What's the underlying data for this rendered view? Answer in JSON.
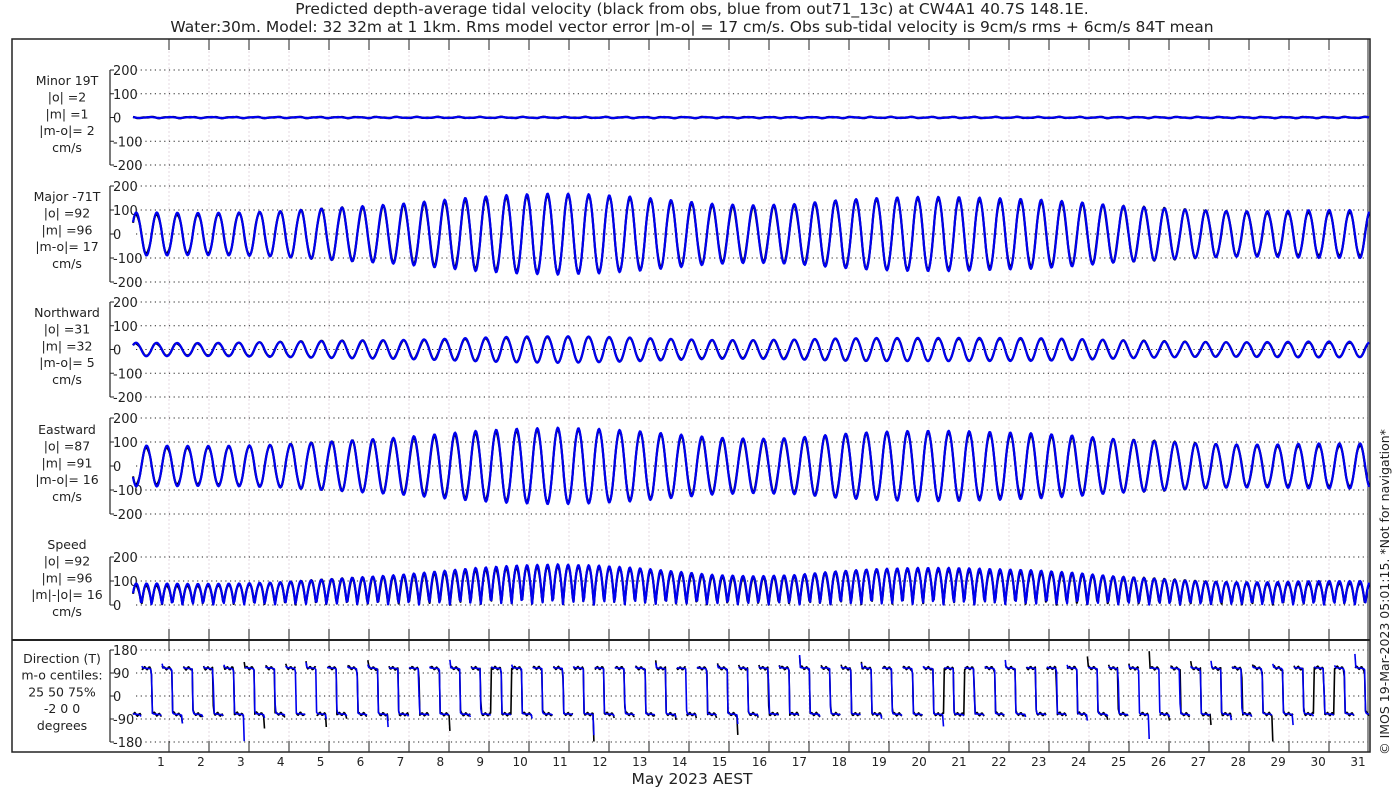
{
  "chart_data": {
    "type": "line",
    "title": "Predicted depth-average tidal velocity (black from obs, blue from out71_13c) at CW4A1 40.7S 148.1E.",
    "subtitle": "Water:30m. Model: 32 32m at 1 1km. Rms model vector error |m-o| = 17 cm/s. Obs sub-tidal velocity is 9cm/s rms + 6cm/s 84T mean",
    "xlabel": "May 2023 AEST",
    "x_tick_labels": [
      "1",
      "2",
      "3",
      "4",
      "5",
      "6",
      "7",
      "8",
      "9",
      "10",
      "11",
      "12",
      "13",
      "14",
      "15",
      "16",
      "17",
      "18",
      "19",
      "20",
      "21",
      "22",
      "23",
      "24",
      "25",
      "26",
      "27",
      "28",
      "29",
      "30",
      "31"
    ],
    "xlim_days": [
      0.35,
      31.45
    ],
    "grid": true,
    "series_colors": {
      "obs": "#000000",
      "model": "#0000ee"
    },
    "tidal_period_days": 0.5175,
    "major_axis_deg": -71,
    "major_envelope_cm_s_by_day": [
      90,
      90,
      88,
      90,
      95,
      105,
      115,
      125,
      140,
      155,
      165,
      170,
      165,
      155,
      140,
      125,
      120,
      125,
      140,
      150,
      155,
      155,
      150,
      145,
      135,
      120,
      110,
      100,
      95,
      95,
      100,
      100
    ],
    "minor_amplitude_cm_s": 2,
    "panels": [
      {
        "id": "minor",
        "labels": [
          "Minor 19T",
          "|o| =2",
          "|m| =1",
          "|m-o|= 2",
          "cm/s"
        ],
        "yticks": [
          200,
          100,
          0,
          -100,
          -200
        ],
        "ylim": [
          -200,
          200
        ]
      },
      {
        "id": "major",
        "labels": [
          "Major -71T",
          "|o| =92",
          "|m| =96",
          "|m-o|= 17",
          "cm/s"
        ],
        "yticks": [
          200,
          100,
          0,
          -100,
          -200
        ],
        "ylim": [
          -200,
          200
        ]
      },
      {
        "id": "north",
        "labels": [
          "Northward",
          "|o| =31",
          "|m| =32",
          "|m-o|= 5",
          "cm/s"
        ],
        "yticks": [
          200,
          100,
          0,
          -100,
          -200
        ],
        "ylim": [
          -200,
          200
        ]
      },
      {
        "id": "east",
        "labels": [
          "Eastward",
          "|o| =87",
          "|m| =91",
          "|m-o|= 16",
          "cm/s"
        ],
        "yticks": [
          200,
          100,
          0,
          -100,
          -200
        ],
        "ylim": [
          -200,
          200
        ]
      },
      {
        "id": "speed",
        "labels": [
          "Speed",
          "|o| =92",
          "|m| =96",
          "|m|-|o|= 16",
          "cm/s"
        ],
        "yticks": [
          200,
          100,
          0
        ],
        "ylim": [
          0,
          200
        ]
      },
      {
        "id": "direction",
        "labels": [
          "Direction (T)",
          "m-o centiles:",
          "25  50  75%",
          "-2  0  0",
          "degrees"
        ],
        "yticks": [
          180,
          90,
          0,
          -90,
          -180
        ],
        "ylim": [
          -180,
          180
        ]
      }
    ],
    "side_note": "© IMOS 19-Mar-2023 05:01:15. *Not for navigation*"
  }
}
